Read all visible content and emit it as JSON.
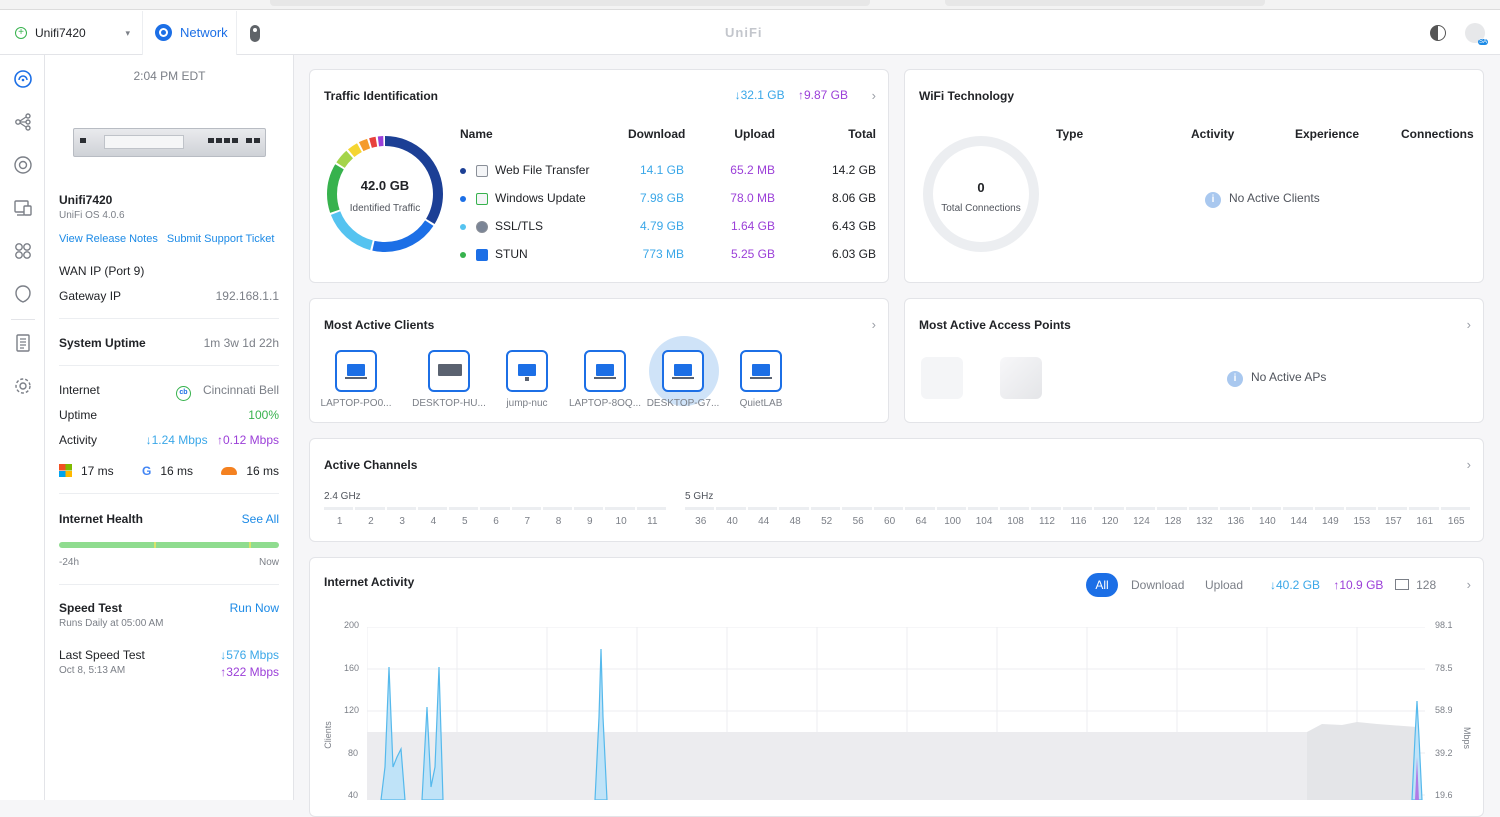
{
  "topbar": {
    "site_name": "Unifi7420",
    "app_tab": "Network",
    "brand": "UniFi"
  },
  "device": {
    "time": "2:04 PM EDT",
    "name": "Unifi7420",
    "os": "UniFi OS 4.0.6",
    "release_notes": "View Release Notes",
    "support_ticket": "Submit Support Ticket",
    "wan_ip_label": "WAN IP (Port 9)",
    "gateway_ip_label": "Gateway IP",
    "gateway_ip": "192.168.1.1",
    "uptime_label": "System Uptime",
    "uptime": "1m 3w 1d 22h",
    "internet_label": "Internet",
    "isp": "Cincinnati Bell",
    "isp_logo": "cb",
    "internet_uptime_label": "Uptime",
    "internet_uptime": "100%",
    "activity_label": "Activity",
    "activity_down": "↓1.24 Mbps",
    "activity_up": "↑0.12 Mbps",
    "latency": [
      {
        "icon": "microsoft-icon",
        "value": "17 ms"
      },
      {
        "icon": "google-icon",
        "value": "16 ms"
      },
      {
        "icon": "cloudflare-icon",
        "value": "16 ms"
      }
    ],
    "health_label": "Internet Health",
    "health_see_all": "See All",
    "health_start": "-24h",
    "health_end": "Now",
    "speedtest_label": "Speed Test",
    "speedtest_run": "Run Now",
    "speedtest_schedule": "Runs Daily at 05:00 AM",
    "last_speedtest_label": "Last Speed Test",
    "last_speedtest_date": "Oct 8, 5:13 AM",
    "last_speedtest_down": "↓576 Mbps",
    "last_speedtest_up": "↑322 Mbps"
  },
  "traffic": {
    "title": "Traffic Identification",
    "total_down": "↓32.1 GB",
    "total_up": "↑9.87 GB",
    "donut_value": "42.0 GB",
    "donut_label": "Identified Traffic",
    "headers": {
      "name": "Name",
      "download": "Download",
      "upload": "Upload",
      "total": "Total"
    },
    "rows": [
      {
        "name": "Web File Transfer",
        "download": "14.1 GB",
        "upload": "65.2 MB",
        "total": "14.2 GB",
        "color": "#1c3f95"
      },
      {
        "name": "Windows Update",
        "download": "7.98 GB",
        "upload": "78.0 MB",
        "total": "8.06 GB",
        "color": "#1c6fe6"
      },
      {
        "name": "SSL/TLS",
        "download": "4.79 GB",
        "upload": "1.64 GB",
        "total": "6.43 GB",
        "color": "#55c3f0"
      },
      {
        "name": "STUN",
        "download": "773 MB",
        "upload": "5.25 GB",
        "total": "6.03 GB",
        "color": "#37b24d"
      }
    ]
  },
  "wifi": {
    "title": "WiFi Technology",
    "headers": {
      "type": "Type",
      "activity": "Activity",
      "experience": "Experience",
      "connections": "Connections"
    },
    "total_value": "0",
    "total_label": "Total Connections",
    "empty": "No Active Clients"
  },
  "clients": {
    "title": "Most Active Clients",
    "items": [
      "LAPTOP-PO0...",
      "DESKTOP-HU...",
      "jump-nuc",
      "LAPTOP-8OQ...",
      "DESKTOP-G7...",
      "QuietLAB"
    ]
  },
  "aps": {
    "title": "Most Active Access Points",
    "empty": "No Active APs"
  },
  "channels": {
    "title": "Active Channels",
    "band24": "2.4 GHz",
    "band5": "5 GHz",
    "ch24": [
      "1",
      "2",
      "3",
      "4",
      "5",
      "6",
      "7",
      "8",
      "9",
      "10",
      "11"
    ],
    "ch5": [
      "36",
      "40",
      "44",
      "48",
      "52",
      "56",
      "60",
      "64",
      "100",
      "104",
      "108",
      "112",
      "116",
      "120",
      "124",
      "128",
      "132",
      "136",
      "140",
      "144",
      "149",
      "153",
      "157",
      "161",
      "165"
    ]
  },
  "activity": {
    "title": "Internet Activity",
    "tabs": [
      "All",
      "Download",
      "Upload"
    ],
    "down": "↓40.2 GB",
    "up": "↑10.9 GB",
    "clients": "128",
    "y_left_label": "Clients",
    "y_right_label": "Mbps",
    "y_left": [
      "200",
      "160",
      "120",
      "80",
      "40"
    ],
    "y_right": [
      "98.1",
      "78.5",
      "58.9",
      "39.2",
      "19.6"
    ]
  }
}
